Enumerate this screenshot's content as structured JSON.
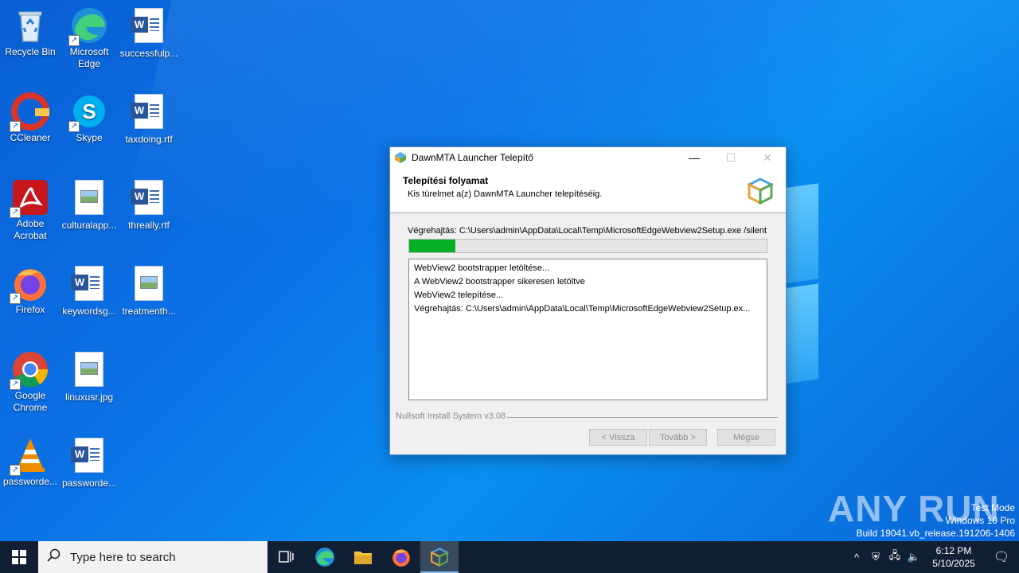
{
  "desktop": {
    "icons": [
      {
        "label": "Recycle Bin"
      },
      {
        "label": "Microsoft Edge"
      },
      {
        "label": "successfulp..."
      },
      {
        "label": "CCleaner"
      },
      {
        "label": "Skype"
      },
      {
        "label": "taxdoing.rtf"
      },
      {
        "label": "Adobe Acrobat"
      },
      {
        "label": "culturalapp..."
      },
      {
        "label": "threally.rtf"
      },
      {
        "label": "Firefox"
      },
      {
        "label": "keywordsg..."
      },
      {
        "label": "treatmenth..."
      },
      {
        "label": "Google Chrome"
      },
      {
        "label": "linuxusr.jpg"
      },
      {
        "label": "VLC media player"
      },
      {
        "label": "passworde..."
      }
    ]
  },
  "dialog": {
    "title": "DawnMTA Launcher Telepítő",
    "minimize": "—",
    "maximize": "☐",
    "close": "✕",
    "header_title": "Telepítési folyamat",
    "header_subtitle": "Kis türelmet a(z) DawnMTA Launcher telepítéséig.",
    "exec_line": "Végrehajtás: C:\\Users\\admin\\AppData\\Local\\Temp\\MicrosoftEdgeWebview2Setup.exe /silent",
    "progress": 0.13,
    "log": [
      "WebView2 bootstrapper letöltése...",
      "A WebView2 bootstrapper sikeresen letöltve",
      "WebView2 telepítése...",
      "Végrehajtás: C:\\Users\\admin\\AppData\\Local\\Temp\\MicrosoftEdgeWebview2Setup.ex..."
    ],
    "branding": "Nullsoft Install System v3.08",
    "back_button": "< Vissza",
    "next_button": "Tovább >",
    "cancel_button": "Mégse"
  },
  "watermark": {
    "text": "ANY RUN",
    "line1": "Test Mode",
    "line2": "Windows 10 Pro",
    "line3": "Build 19041.vb_release.191206-1406"
  },
  "taskbar": {
    "search_placeholder": "Type here to search",
    "time": "6:12 PM",
    "date": "5/10/2025"
  },
  "colors": {
    "progress_fill": "#06b025",
    "taskbar_bg": "#101f33",
    "desktop_blue": "#0b72e6"
  }
}
